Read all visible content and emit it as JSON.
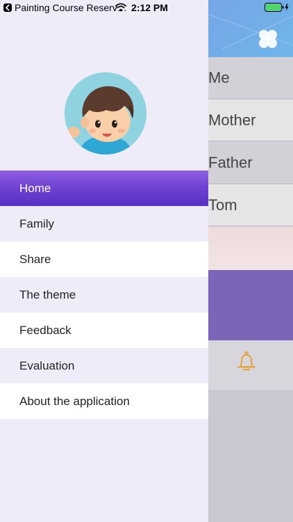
{
  "status_bar": {
    "app_name": "Painting Course Reserv…",
    "time": "2:12 PM"
  },
  "drawer": {
    "menu": [
      {
        "label": "Home",
        "active": true
      },
      {
        "label": "Family",
        "active": false
      },
      {
        "label": "Share",
        "active": false
      },
      {
        "label": "The theme",
        "active": false
      },
      {
        "label": "Feedback",
        "active": false
      },
      {
        "label": "Evaluation",
        "active": false
      },
      {
        "label": "About the application",
        "active": false
      }
    ]
  },
  "main": {
    "members": [
      "Me",
      "Mother",
      "Father",
      "Tom"
    ],
    "icons": {
      "header": "clover-icon",
      "reminder": "bell-icon"
    }
  },
  "colors": {
    "drawer_bg": "#eeecf8",
    "active_item": "#6a3fd0",
    "purple_block": "#7b65b9",
    "bell": "#e3a33a",
    "battery": "#4cd964"
  }
}
